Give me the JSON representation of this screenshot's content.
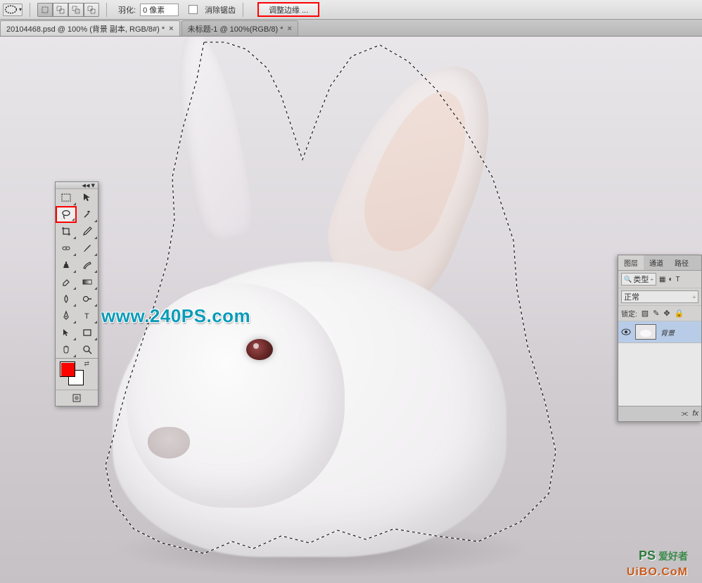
{
  "options_bar": {
    "feather_label": "羽化:",
    "feather_value": "0 像素",
    "antialias_label": "消除锯齿",
    "refine_edge_label": "调整边缘 ..."
  },
  "tabs": {
    "tab1": "20104468.psd @ 100% (背景 副本, RGB/8#) *",
    "tab2": "未标题-1 @ 100%(RGB/8) *"
  },
  "toolbox": {
    "fg_color": "#ff0000",
    "bg_color": "#ffffff"
  },
  "layers_panel": {
    "tab_layers": "图层",
    "tab_channels": "通道",
    "tab_paths": "路径",
    "filter_kind_label": "类型",
    "blend_mode": "正常",
    "lock_label": "锁定:",
    "layer1_name": "背景"
  },
  "watermarks": {
    "main": "www.240PS.com",
    "br_ps": "PS",
    "br_cn": "爱好者",
    "br_domain": "UiBO.CoM"
  }
}
